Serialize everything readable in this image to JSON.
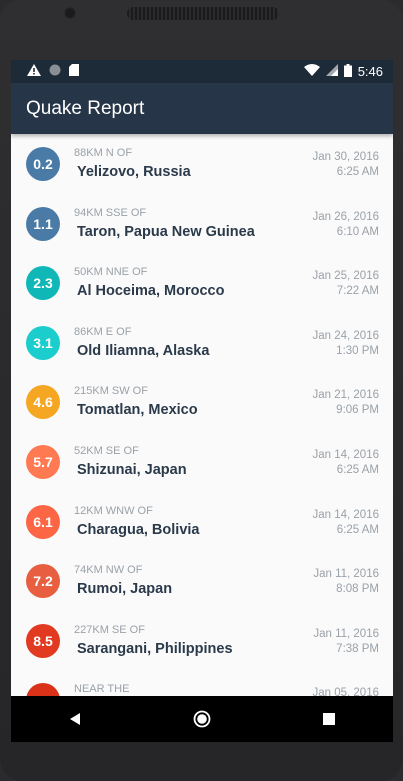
{
  "status_bar": {
    "time": "5:46",
    "icons": [
      "warning-icon",
      "circle-icon",
      "sd-card-icon",
      "wifi-icon",
      "signal-icon",
      "battery-icon"
    ]
  },
  "app_bar": {
    "title": "Quake Report",
    "color": "#263648"
  },
  "earthquakes": [
    {
      "magnitude": "0.2",
      "offset": "88KM N OF",
      "place": "Yelizovo, Russia",
      "date": "Jan 30, 2016",
      "time": "6:25 AM",
      "color": "#4a7ba6"
    },
    {
      "magnitude": "1.1",
      "offset": "94KM SSE OF",
      "place": "Taron, Papua New Guinea",
      "date": "Jan 26, 2016",
      "time": "6:10 AM",
      "color": "#4a7ba6"
    },
    {
      "magnitude": "2.3",
      "offset": "50KM NNE OF",
      "place": "Al Hoceima, Morocco",
      "date": "Jan 25, 2016",
      "time": "7:22 AM",
      "color": "#10b7b7"
    },
    {
      "magnitude": "3.1",
      "offset": "86KM E OF",
      "place": "Old Iliamna, Alaska",
      "date": "Jan 24, 2016",
      "time": "1:30 PM",
      "color": "#1bcdcd"
    },
    {
      "magnitude": "4.6",
      "offset": "215KM SW OF",
      "place": "Tomatlan, Mexico",
      "date": "Jan 21, 2016",
      "time": "9:06 PM",
      "color": "#f5a623"
    },
    {
      "magnitude": "5.7",
      "offset": "52KM SE OF",
      "place": "Shizunai, Japan",
      "date": "Jan 14, 2016",
      "time": "6:25 AM",
      "color": "#ff7952"
    },
    {
      "magnitude": "6.1",
      "offset": "12KM WNW OF",
      "place": "Charagua, Bolivia",
      "date": "Jan 14, 2016",
      "time": "6:25 AM",
      "color": "#fc6644"
    },
    {
      "magnitude": "7.2",
      "offset": "74KM NW OF",
      "place": "Rumoi, Japan",
      "date": "Jan 11, 2016",
      "time": "8:08 PM",
      "color": "#e75f40"
    },
    {
      "magnitude": "8.5",
      "offset": "227KM SE OF",
      "place": "Sarangani, Philippines",
      "date": "Jan 11, 2016",
      "time": "7:38 PM",
      "color": "#e13a20"
    },
    {
      "magnitude": "",
      "offset": "NEAR THE",
      "place": "",
      "date": "Jan 05, 2016",
      "time": "",
      "color": "#d93218"
    }
  ],
  "nav_bar": {
    "buttons": [
      "back-icon",
      "home-icon",
      "recents-icon"
    ]
  }
}
